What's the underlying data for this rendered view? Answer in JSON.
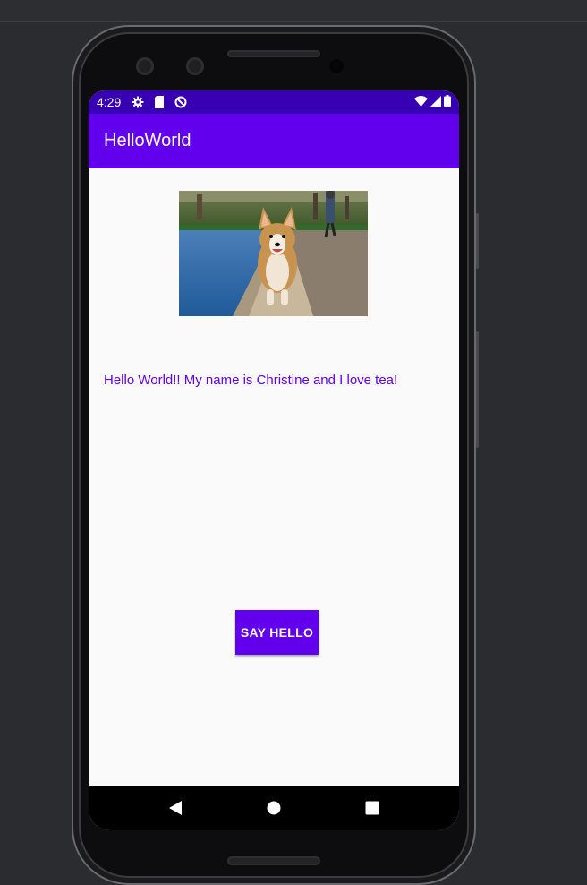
{
  "status_bar": {
    "time": "4:29",
    "left_icons": [
      "gear-icon",
      "sd-card-icon",
      "data-saver-icon"
    ],
    "right_icons": [
      "wifi-icon",
      "cell-signal-icon",
      "battery-icon"
    ],
    "color": "#3700b3"
  },
  "app_bar": {
    "title": "HelloWorld",
    "color": "#6200ee"
  },
  "main": {
    "image": "corgi-photo",
    "message": "Hello World!! My name is Christine and I love tea!",
    "message_color": "#6200ee",
    "button_label": "SAY HELLO",
    "button_color": "#6200ee"
  },
  "nav_bar": {
    "buttons": [
      "back-icon",
      "home-icon",
      "recents-icon"
    ]
  }
}
